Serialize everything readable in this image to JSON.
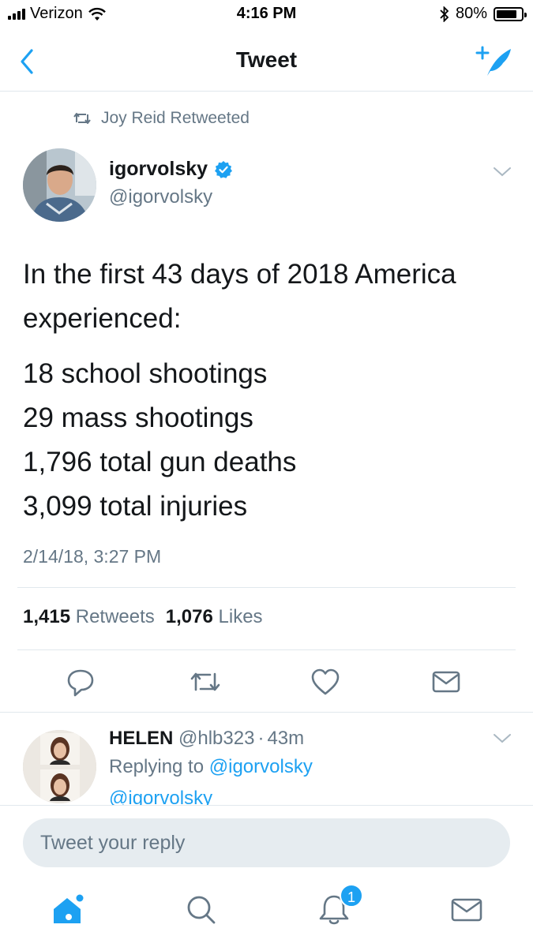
{
  "status_bar": {
    "carrier": "Verizon",
    "time": "4:16 PM",
    "battery": "80%",
    "battery_level": 0.8
  },
  "header": {
    "title": "Tweet",
    "back_icon": "chevron-left-icon",
    "compose_icon": "compose-feather-icon"
  },
  "tweet": {
    "retweeted_by": "Joy Reid Retweeted",
    "author_name": "igorvolsky",
    "author_handle": "@igorvolsky",
    "verified": true,
    "text_intro": "In the first 43 days of 2018 America experienced:",
    "lines": [
      "18 school shootings",
      "29 mass shootings",
      "1,796 total gun deaths",
      "3,099 total injuries"
    ],
    "timestamp": "2/14/18, 3:27 PM",
    "retweet_count": "1,415",
    "retweet_label": "Retweets",
    "like_count": "1,076",
    "like_label": "Likes"
  },
  "reply": {
    "name": "HELEN",
    "handle": "@hlb323",
    "separator": "·",
    "age": "43m",
    "replying_prefix": "Replying to",
    "replying_to": "@igorvolsky",
    "body_preview": "@igorvolsky"
  },
  "composer": {
    "placeholder": "Tweet your reply"
  },
  "tabbar": {
    "notifications_badge": "1"
  },
  "colors": {
    "accent": "#1da1f2",
    "secondary_text": "#657786",
    "divider": "#e1e8ed"
  }
}
